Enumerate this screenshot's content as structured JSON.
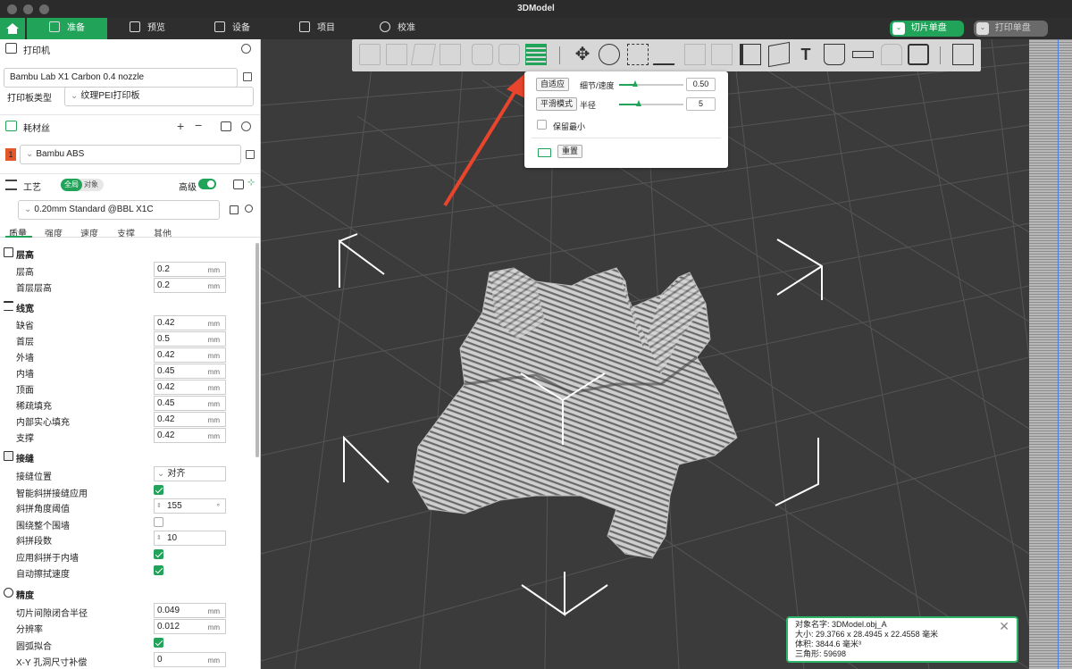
{
  "window": {
    "title": "3DModel"
  },
  "tabs": [
    {
      "label": "准备",
      "icon": "cube-icon"
    },
    {
      "label": "预览",
      "icon": "layers-icon"
    },
    {
      "label": "设备",
      "icon": "monitor-icon"
    },
    {
      "label": "项目",
      "icon": "document-icon"
    },
    {
      "label": "校准",
      "icon": "gear-icon"
    }
  ],
  "actions": {
    "slice": "切片单盘",
    "print": "打印单盘"
  },
  "printer": {
    "section": "打印机",
    "name": "Bambu Lab X1 Carbon 0.4 nozzle",
    "plate_label": "打印板类型",
    "plate_value": "纹理PEI打印板"
  },
  "filament": {
    "section": "耗材丝",
    "slot": "1",
    "name": "Bambu ABS"
  },
  "process": {
    "section": "工艺",
    "global": "全局",
    "object": "对象",
    "advanced": "高级",
    "preset": "0.20mm Standard @BBL X1C",
    "tabs": [
      "质量",
      "强度",
      "速度",
      "支撑",
      "其他"
    ]
  },
  "groups": {
    "layer": {
      "title": "层高",
      "rows": [
        {
          "label": "层高",
          "value": "0.2",
          "unit": "mm"
        },
        {
          "label": "首层层高",
          "value": "0.2",
          "unit": "mm"
        }
      ]
    },
    "width": {
      "title": "线宽",
      "rows": [
        {
          "label": "缺省",
          "value": "0.42",
          "unit": "mm"
        },
        {
          "label": "首层",
          "value": "0.5",
          "unit": "mm"
        },
        {
          "label": "外墙",
          "value": "0.42",
          "unit": "mm"
        },
        {
          "label": "内墙",
          "value": "0.45",
          "unit": "mm"
        },
        {
          "label": "顶面",
          "value": "0.42",
          "unit": "mm"
        },
        {
          "label": "稀疏填充",
          "value": "0.45",
          "unit": "mm"
        },
        {
          "label": "内部实心填充",
          "value": "0.42",
          "unit": "mm"
        },
        {
          "label": "支撑",
          "value": "0.42",
          "unit": "mm"
        }
      ]
    },
    "seam": {
      "title": "接缝",
      "position_label": "接缝位置",
      "position_value": "对齐",
      "smart_label": "智能斜拼接缝应用",
      "angle_label": "斜拼角度阈值",
      "angle_value": "155",
      "angle_unit": "°",
      "around_label": "围绕整个围墙",
      "segments_label": "斜拼段数",
      "segments_value": "10",
      "inner_label": "应用斜拼于内墙",
      "wipe_label": "自动擦拭速度"
    },
    "precision": {
      "title": "精度",
      "gap_label": "切片间隙闭合半径",
      "gap_value": "0.049",
      "gap_unit": "mm",
      "res_label": "分辨率",
      "res_value": "0.012",
      "res_unit": "mm",
      "arc_label": "圆弧拟合",
      "xy_label": "X-Y 孔洞尺寸补偿",
      "xy_value": "0",
      "xy_unit": "mm"
    }
  },
  "popup": {
    "adaptive": "自适应",
    "detail_label": "细节/速度",
    "detail_value": "0.50",
    "detail_level": 0.25,
    "smooth": "平滑模式",
    "radius_label": "半径",
    "radius_value": "5",
    "radius_level": 0.3,
    "keep_min": "保留最小",
    "reset": "重置"
  },
  "info": {
    "name_label": "对象名字:",
    "name_value": "3DModel.obj_A",
    "size_label": "大小:",
    "size_value": "29.3766 x 28.4945 x 22.4558 毫米",
    "volume_label": "体积:",
    "volume_value": "3844.6 毫米³",
    "tri_label": "三角形:",
    "tri_value": "59698"
  },
  "colors": {
    "accent": "#21a35a",
    "arrow": "#e8452c"
  }
}
